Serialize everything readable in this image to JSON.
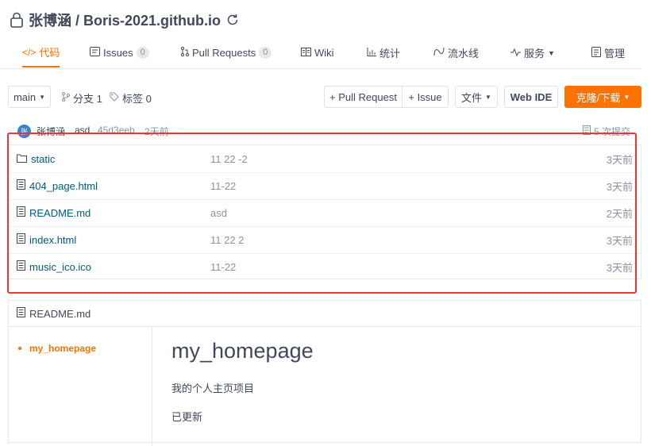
{
  "repo": {
    "title": "张博涵 / Boris-2021.github.io"
  },
  "tabs": [
    {
      "label": "代码",
      "icon": "code-icon",
      "active": true
    },
    {
      "label": "Issues",
      "count": "0",
      "icon": "issues-icon"
    },
    {
      "label": "Pull Requests",
      "count": "0",
      "icon": "pull-request-icon"
    },
    {
      "label": "Wiki",
      "icon": "wiki-icon"
    },
    {
      "label": "统计",
      "icon": "stats-icon"
    },
    {
      "label": "流水线",
      "icon": "pipeline-icon"
    },
    {
      "label": "服务",
      "icon": "service-icon"
    },
    {
      "label": "管理",
      "icon": "manage-icon"
    }
  ],
  "toolbar": {
    "branch": "main",
    "branches": "分支 1",
    "tags": "标签 0",
    "new_pr": "+ Pull Request",
    "new_issue": "+ Issue",
    "file_menu": "文件",
    "web_ide": "Web IDE",
    "clone": "克隆/下载"
  },
  "commit": {
    "avatar_text": "张",
    "author": "张博涵",
    "message": "asd",
    "hash": "45d3eeb",
    "time": "2天前",
    "count": "5 次提交"
  },
  "files": [
    {
      "name": "static",
      "type": "folder",
      "message": "11 22 -2",
      "time": "3天前"
    },
    {
      "name": "404_page.html",
      "type": "file",
      "message": "11-22",
      "time": "3天前"
    },
    {
      "name": "README.md",
      "type": "file",
      "message": "asd",
      "time": "2天前"
    },
    {
      "name": "index.html",
      "type": "file",
      "message": "11 22 2",
      "time": "3天前"
    },
    {
      "name": "music_ico.ico",
      "type": "file",
      "message": "11-22",
      "time": "3天前"
    }
  ],
  "readme": {
    "filename": "README.md",
    "toc": [
      "my_homepage"
    ],
    "heading": "my_homepage",
    "paragraphs": [
      "我的个人主页项目",
      "已更新"
    ]
  },
  "colors": {
    "accent": "#fe7300",
    "link": "#005980",
    "highlight_box": "#e8363a"
  }
}
